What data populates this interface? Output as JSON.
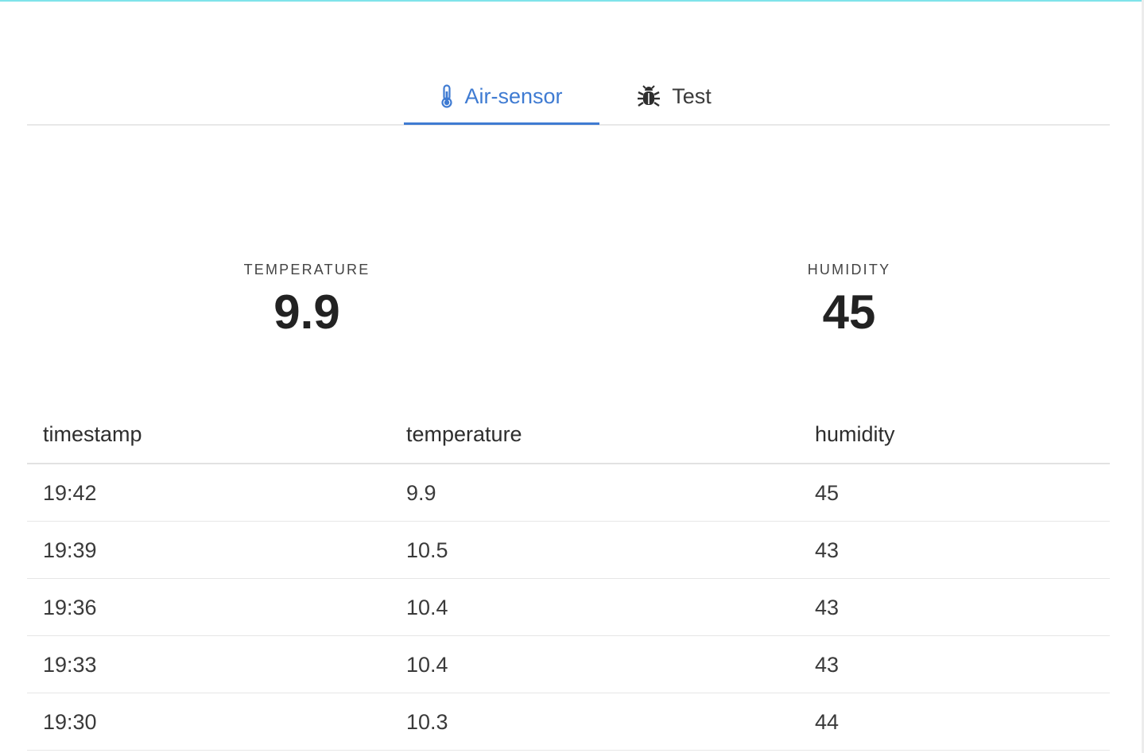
{
  "tabs": [
    {
      "label": "Air-sensor",
      "icon": "thermometer-icon",
      "active": true,
      "color": "#3f7bd2"
    },
    {
      "label": "Test",
      "icon": "bug-icon",
      "active": false
    }
  ],
  "stats": {
    "temperature": {
      "title": "TEMPERATURE",
      "value": "9.9"
    },
    "humidity": {
      "title": "HUMIDITY",
      "value": "45"
    }
  },
  "table": {
    "headers": [
      "timestamp",
      "temperature",
      "humidity"
    ],
    "rows": [
      [
        "19:42",
        "9.9",
        "45"
      ],
      [
        "19:39",
        "10.5",
        "43"
      ],
      [
        "19:36",
        "10.4",
        "43"
      ],
      [
        "19:33",
        "10.4",
        "43"
      ],
      [
        "19:30",
        "10.3",
        "44"
      ]
    ]
  }
}
